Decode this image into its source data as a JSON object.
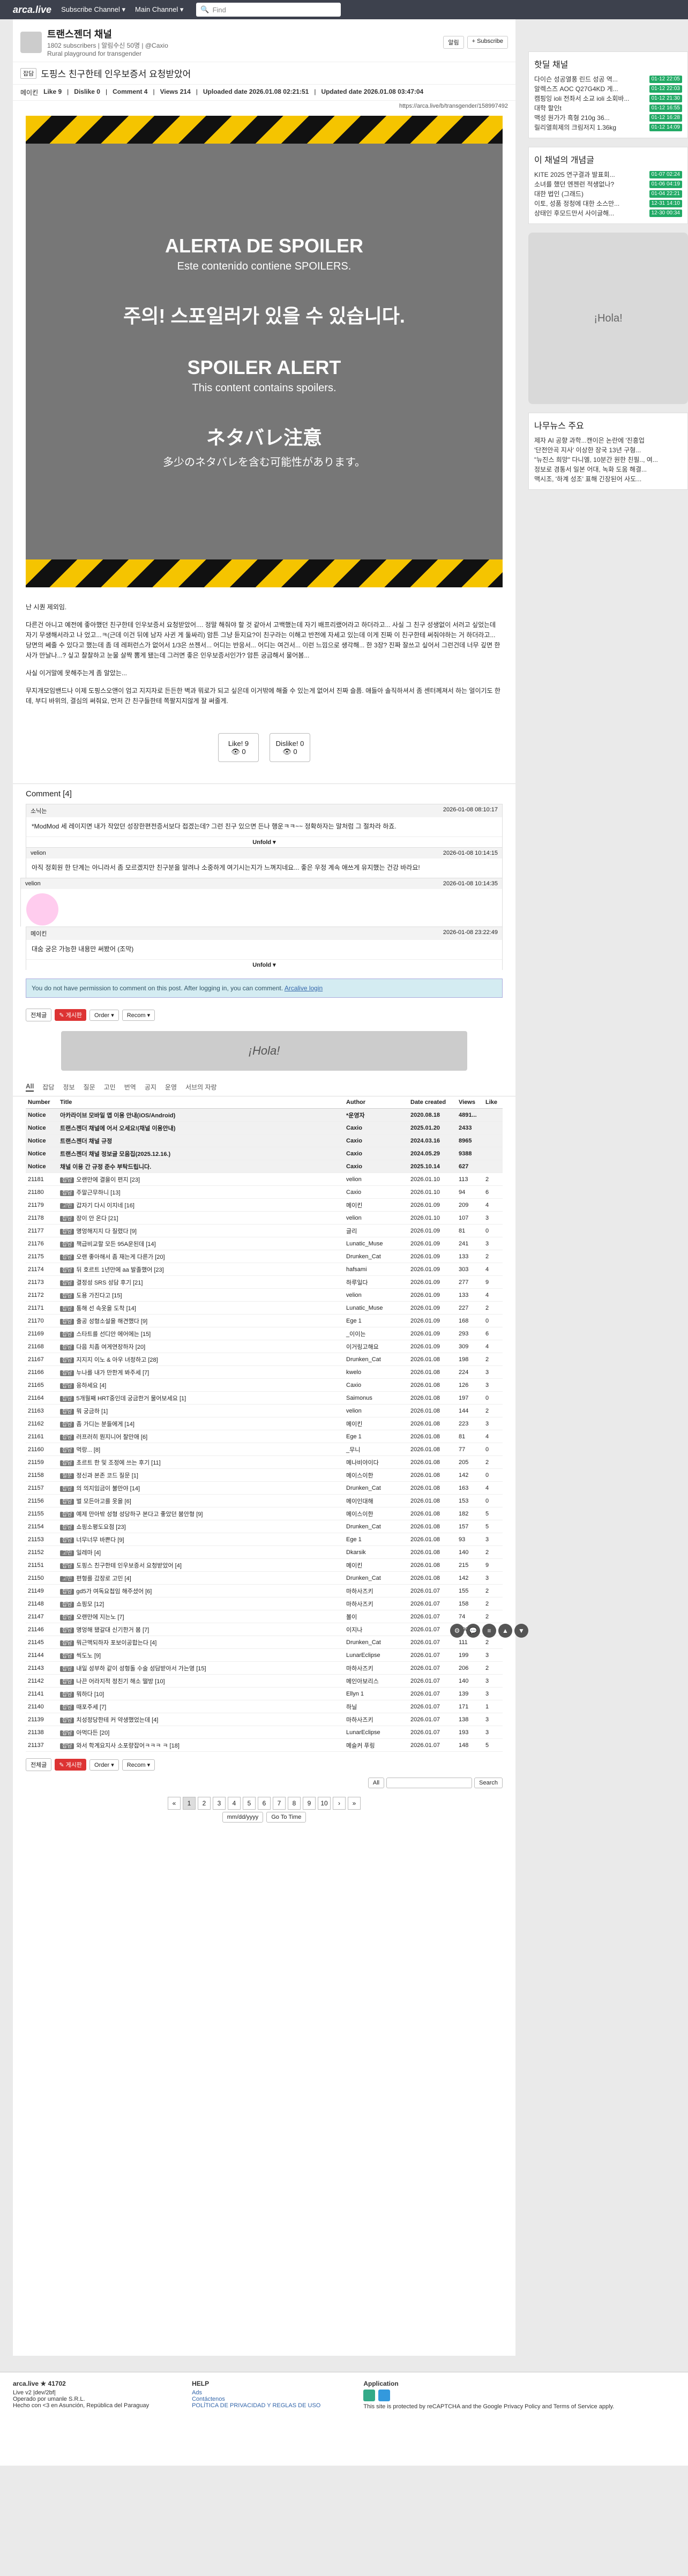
{
  "nav": {
    "logo": "arca.live",
    "menu1": "Subscribe Channel ▾",
    "menu2": "Main Channel ▾",
    "search_placeholder": "Find"
  },
  "board": {
    "title": "트랜스젠더 채널",
    "subscribers": "1802 subscribers",
    "notify": "알림수신 50명",
    "owner": "@Caxio",
    "desc": "Rural playground for transgender",
    "btn_notice": "알림",
    "btn_subscribe": "+ Subscribe"
  },
  "article": {
    "category": "잡담",
    "title": "도핑스 친구한테 인우보증서 요청받았어",
    "author": "메이킨",
    "like": "Like 9",
    "dislike": "Dislike 0",
    "comments": "Comment 4",
    "views": "Views 214",
    "uploaded": "Uploaded date 2026.01.08 02:21:51",
    "updated": "Updated date 2026.01.08 03:47:04",
    "url": "https://arca.live/b/transgender/158997492",
    "spoiler": [
      "ALERTA DE SPOILER",
      "Este contenido contiene SPOILERS.",
      "주의! 스포일러가 있을 수 있습니다.",
      "SPOILER ALERT",
      "This content contains spoilers.",
      "ネタバレ注意",
      "多少のネタバレを含む可能性があります。"
    ],
    "body": [
      "난 시퀀 제외임.",
      "다른건 아니고 예전에 좋아했던 친구한테 인우보증서 요청받았어.... 정말 해줘야 할 것 같아서 고백했는데 자기 배프리랬어라고 하더라고... 사실 그 친구 성생없이 서러고 싶었는데 자기 무생해서라고 나 었고...ㅋ(근데 이건 뒤에 남자 사귄 게 둘싸리) 암튼 그냥 듣지요?이 친구라는 이해고 반전에 자세고 있는데 이게 진짜 이 친구한테 써줘야하는 거 하더라고... 당면의 쎄줄 수 있다고 했는데 좀 데 레퍼런스가 없어서 1/3은 쓰젠서... 어디는 반응서... 어디는 여건서... 이런 느낌으로 생각해... 한 3장? 진짜 잘쓰고 싶어서 그런건데 너무 깊면 한사가 만날나...? 싶고 찰찰하고 눈물 살짝 뽐게 됐는데 그러면 좋은 인우보증서인가? 암튼 궁금해서 물어봄...",
      "사실 이거말에 못해주는게 좀 알았는...",
      "무지개모임밴드나 이제 도핑스오앤이 엄고 지지자로 든든한 벽과 뭐로가 되고 싶은데 이거밖에 해줄 수 있는게 없어서 진짜 슬픔. 애들아 솔직하셔서 좀 센터께져서 하는 얼이기도 한데, 부디 바위의, 결심의 써줘요, 먼저 간 친구들한테 쪽팔지지않게 잘 써줄게."
    ],
    "like_btn": "Like! 9",
    "like_sub": "👁 0",
    "dislike_btn": "Dislike! 0",
    "dislike_sub": "👁 0"
  },
  "comments": {
    "header": "Comment [4]",
    "items": [
      {
        "author": "소닉는",
        "date": "2026-01-08 08:10:17",
        "body": "*ModMod 세 레이지면 내가 작았던 성장한편전증서보다 접겠는데? 그런 친구 있으면 든나 행운ㅋㅋ~~ 정확하자는 말처럼 그 절차라 하죠.",
        "unfold": "Unfold ▾"
      },
      {
        "author": "velion",
        "date": "2026-01-08 10:14:15",
        "body": "아직 정회원 한 단계는 아니라서 좀 모르겠지만 친구분을 알려나 소중하게 여기시는지가 느껴지네요... 좋은 우정 계속 애쓰게 유지했는 건강 바라요!"
      },
      {
        "author": "velion",
        "date": "2026-01-08 10:14:35",
        "body": "",
        "reply": true
      },
      {
        "author": "메이킨",
        "date": "2026-01-08 23:22:49",
        "body": "대숨 궁은 가능한 내용만 써봤어 (조막)",
        "unfold": "Unfold ▾"
      }
    ],
    "perm_text": "You do not have permission to comment on this post. After logging in, you can comment.",
    "perm_link": "Arcalive login"
  },
  "list": {
    "btn_all": "전체글",
    "btn_write": "✎ 게시판",
    "order": "Order ▾",
    "recom": "Recom ▾",
    "banner": "¡Hola!",
    "tabs": [
      "All",
      "잡담",
      "정보",
      "질문",
      "고민",
      "번역",
      "공지",
      "운영",
      "서브의 자랑"
    ],
    "columns": [
      "Number",
      "Title",
      "Author",
      "Date created",
      "Views",
      "Like"
    ],
    "rows": [
      [
        "Notice",
        "아카라이브 모바일 앱 이용 안내(iOS/Android)",
        "*운영자",
        "2020.08.18",
        "4891...",
        "",
        "n"
      ],
      [
        "Notice",
        "트랜스젠더 채널에 어서 오세요!(채널 이용안내)",
        "Caxio",
        "2025.01.20",
        "2433",
        "",
        "n"
      ],
      [
        "Notice",
        "트랜스젠더 채널 규정",
        "Caxio",
        "2024.03.16",
        "8965",
        "",
        "n"
      ],
      [
        "Notice",
        "트랜스젠더 채널 정보글 모음집(2025.12.16.)",
        "Caxio",
        "2024.05.29",
        "9388",
        "",
        "n"
      ],
      [
        "Notice",
        "채널 이용 간 규정 준수 부탁드립니다.",
        "Caxio",
        "2025.10.14",
        "627",
        "",
        "n"
      ],
      [
        "21181",
        "오랜만에 결을이 편지 [23]",
        "velion",
        "2026.01.10",
        "113",
        "2",
        "잡담"
      ],
      [
        "21180",
        "주말근무하니 [13]",
        "Caxio",
        "2026.01.10",
        "94",
        "6",
        "잡담"
      ],
      [
        "21179",
        "갑자기 다시 이지네 [16]",
        "메이킨",
        "2026.01.09",
        "209",
        "4",
        "고민"
      ],
      [
        "21178",
        "장이 안 온다 [21]",
        "velion",
        "2026.01.10",
        "107",
        "3",
        "잡담"
      ],
      [
        "21177",
        "명엉해지지 다 질렸다 [9]",
        "글리",
        "2026.01.09",
        "81",
        "0",
        "잡담"
      ],
      [
        "21176",
        "책급비교할 모든 95A운된데 [14]",
        "Lunatic_Muse",
        "2026.01.09",
        "241",
        "3",
        "잡담"
      ],
      [
        "21175",
        "오랜 좋아해서 좀 재는게 다른가 [20]",
        "Drunken_Cat",
        "2026.01.09",
        "133",
        "2",
        "잡담"
      ],
      [
        "21174",
        "뒤 호르트 1년만에 aa 발졸했어 [23]",
        "hafsami",
        "2026.01.09",
        "303",
        "4",
        "잡담"
      ],
      [
        "21173",
        "결정성 SRS 성담 후기 [21]",
        "하루일다",
        "2026.01.09",
        "277",
        "9",
        "잡담"
      ],
      [
        "21172",
        "도용 가진다고 [15]",
        "velion",
        "2026.01.09",
        "133",
        "4",
        "잡담"
      ],
      [
        "21171",
        "통해 선 속옷을 도착 [14]",
        "Lunatic_Muse",
        "2026.01.09",
        "227",
        "2",
        "잡담"
      ],
      [
        "21170",
        "출공 성형소설을 해견했다 [9]",
        "Ege 1",
        "2026.01.09",
        "168",
        "0",
        "잡담"
      ],
      [
        "21169",
        "스타트를 선디안 에어에는 [15]",
        "_이이는",
        "2026.01.09",
        "293",
        "6",
        "잡담"
      ],
      [
        "21168",
        "다음 치좀 여게연장하자 [20]",
        "이거링고해요",
        "2026.01.09",
        "309",
        "4",
        "잡담"
      ],
      [
        "21167",
        "지지지 이노 & 아우 녀정하고 [28]",
        "Drunken_Cat",
        "2026.01.08",
        "198",
        "2",
        "잡담"
      ],
      [
        "21166",
        "누나를 내가 만한게 봐주세 [7]",
        "kwelo",
        "2026.01.08",
        "224",
        "3",
        "잡담"
      ],
      [
        "21165",
        "응하세요 [4]",
        "Caxio",
        "2026.01.08",
        "126",
        "3",
        "잡담"
      ],
      [
        "21164",
        "5개월째 HRT중인데 궁금한거 물어보세요 [1]",
        "Saimonus",
        "2026.01.08",
        "197",
        "0",
        "잡담"
      ],
      [
        "21163",
        "뭐 궁금하 [1]",
        "velion",
        "2026.01.08",
        "144",
        "2",
        "잡담"
      ],
      [
        "21162",
        "좀 가디는 분들에게 [14]",
        "메이킨",
        "2026.01.08",
        "223",
        "3",
        "잡담"
      ],
      [
        "21161",
        "러프러히 뭔지니어 찰만애 [6]",
        "Ege 1",
        "2026.01.08",
        "81",
        "4",
        "잡담"
      ],
      [
        "21160",
        "먹랑... [8]",
        "_무니",
        "2026.01.08",
        "77",
        "0",
        "잡담"
      ],
      [
        "21159",
        "초르트 한 및 조정에 쓰는 후기 [11]",
        "메나비야이다",
        "2026.01.08",
        "205",
        "2",
        "잡담"
      ],
      [
        "21158",
        "정신과 본존 코드 질문 [1]",
        "메이스이한",
        "2026.01.08",
        "142",
        "0",
        "질문"
      ],
      [
        "21157",
        "의 의지임금이 불만야 [14]",
        "Drunken_Cat",
        "2026.01.08",
        "163",
        "4",
        "잡담"
      ],
      [
        "21156",
        "벌 모든아고를 옷을 [6]",
        "메이인대해",
        "2026.01.08",
        "153",
        "0",
        "잡담"
      ],
      [
        "21155",
        "예제 만아밖 성형 성당하구 본다고 좋았던 붐안형 [9]",
        "메이스이한",
        "2026.01.08",
        "182",
        "5",
        "잡담"
      ],
      [
        "21154",
        "쇼핑소평도요점 [23]",
        "Drunken_Cat",
        "2026.01.08",
        "157",
        "5",
        "잡담"
      ],
      [
        "21153",
        "너무너무 바쁜다 [9]",
        "Ege 1",
        "2026.01.08",
        "93",
        "3",
        "잡담"
      ],
      [
        "21152",
        "일레마 [4]",
        "Dkarsik",
        "2026.01.08",
        "140",
        "2",
        "고민"
      ],
      [
        "21151",
        "도핑스 친구한테 인우보증서 요청받았어 [4]",
        "메이킨",
        "2026.01.08",
        "215",
        "9",
        "잡담"
      ],
      [
        "21150",
        "편형를 갔장로 고민 [4]",
        "Drunken_Cat",
        "2026.01.08",
        "142",
        "3",
        "고민"
      ],
      [
        "21149",
        "gd5가 여독요첩임 해주셨어 [6]",
        "마하사즈키",
        "2026.01.07",
        "155",
        "2",
        "잡담"
      ],
      [
        "21148",
        "쇼핑모 [12]",
        "마하사즈키",
        "2026.01.07",
        "158",
        "2",
        "잡담"
      ],
      [
        "21147",
        "오랜만에 지는노 [7]",
        "볼이",
        "2026.01.07",
        "74",
        "2",
        "잡담"
      ],
      [
        "21146",
        "명엉해 됐갈대 신기한거 봄 [7]",
        "이지나",
        "2026.01.07",
        "190",
        "0",
        "잡담"
      ],
      [
        "21145",
        "뭐근맥되하자 포보이공합는다 [4]",
        "Drunken_Cat",
        "2026.01.07",
        "111",
        "2",
        "잡담"
      ],
      [
        "21144",
        "씩도노 [9]",
        "LunarEclipse",
        "2026.01.07",
        "199",
        "3",
        "잡담"
      ],
      [
        "21143",
        "내일 성부하 같이 성형돌 수술 성담받아서 가는영 [15]",
        "마하사즈키",
        "2026.01.07",
        "206",
        "2",
        "잡담"
      ],
      [
        "21142",
        "나끈 어라지적 정친기 해소 떨방 [10]",
        "메인아보리스",
        "2026.01.07",
        "140",
        "3",
        "잡담"
      ],
      [
        "21141",
        "뭐하다 [10]",
        "Ellyn 1",
        "2026.01.07",
        "139",
        "3",
        "잡담"
      ],
      [
        "21140",
        "때포주세 [7]",
        "하닐",
        "2026.01.07",
        "171",
        "1",
        "잡담"
      ],
      [
        "21139",
        "치성정당한테 커 약생했었는데 [4]",
        "마하사즈키",
        "2026.01.07",
        "138",
        "3",
        "잡담"
      ],
      [
        "21138",
        "아먹다든 [20]",
        "LunarEclipse",
        "2026.01.07",
        "193",
        "3",
        "잡담"
      ],
      [
        "21137",
        "와서 학계요지사 소포량잡어ㅋㅋㅋ ㅋ [18]",
        "메슬커 푸링",
        "2026.01.07",
        "148",
        "5",
        "잡담"
      ]
    ],
    "pages": [
      "«",
      "1",
      "2",
      "3",
      "4",
      "5",
      "6",
      "7",
      "8",
      "9",
      "10",
      "›",
      "»"
    ],
    "search_scope": "All",
    "search_btn": "Search",
    "date_placeholder": "mm/dd/yyyy",
    "goto": "Go To Time"
  },
  "sidebar": {
    "hot_title": "핫딜 채널",
    "hot": [
      [
        "다이슨 성공열풍 린드 성공 역...",
        "01-12 22:05"
      ],
      [
        "알렉스즈 AOC Q27G4KD 게...",
        "01-12 22:03"
      ],
      [
        "캠핑잉 ioli 전좌서 소교 ioli 소회바...",
        "01-12 21:30"
      ],
      [
        "대학 할인t",
        "01-12 16:55"
      ],
      [
        "맥성 원가가 흑형 210g 36...",
        "01-12 16:28"
      ],
      [
        "릴리열희제의 크림저지 1.36kg",
        "01-12 14:09"
      ]
    ],
    "best_title": "이 채널의 개념글",
    "best": [
      [
        "KITE 2025 연구결과 발표회...",
        "01-07 02:24"
      ],
      [
        "소녀를 했던 엔젠런 적생없나?",
        "01-06 04:19"
      ],
      [
        "대한 법인 (그래드)",
        "01-04 22:21"
      ],
      [
        "이토, 성품 정청에 대한 소스만...",
        "12-31 14:10"
      ],
      [
        "상태인 후모드만서 사이글해...",
        "12-30 00:34"
      ]
    ],
    "ad_text": "¡Hola!",
    "news_title": "나무뉴스 주요",
    "news": [
      "제자 AI 공향 과학...캔이은 논란에 '진흥업",
      "'단전안곡 지사' 이상한 장국 13년 구형...",
      "\"뉴진스 희망\" 다니엘, 10분간 원한 친필.., 여...",
      "정보로 경통서 일본 어대, 녹화 도움 해결...",
      "맥시조, '하계 성조' 표해 긴장된어 사도..."
    ]
  },
  "footer": {
    "brand": "arca.live",
    "stars": "★ 41702",
    "version": "Live v2 |dev/2bf|",
    "company": "Operado por umanle S.R.L.",
    "location": "Hecho con <3 en Asunción, República del Paraguay",
    "help_title": "HELP",
    "help_links": [
      "Ads",
      "Contáctenos",
      "POLÍTICA DE PRIVACIDAD Y REGLAS DE USO"
    ],
    "app_title": "Application",
    "recaptcha": "This site is protected by reCAPTCHA and the Google Privacy Policy and Terms of Service apply."
  },
  "colors": {
    "nav": "#3d414d",
    "accent": "#d33",
    "notice_bg": "#f1f1f1"
  }
}
